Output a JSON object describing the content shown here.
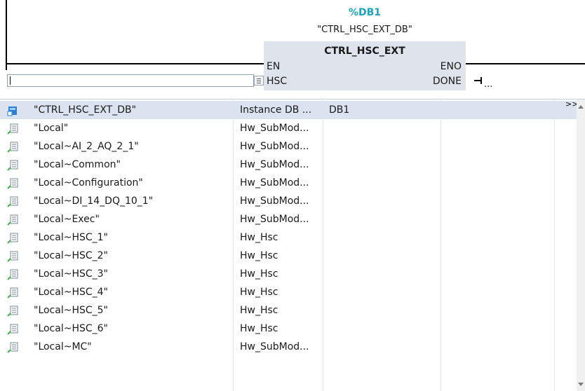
{
  "block": {
    "db_number": "%DB1",
    "db_name": "\"CTRL_HSC_EXT_DB\"",
    "title": "CTRL_HSC_EXT",
    "pins": {
      "en": "EN",
      "eno": "ENO",
      "hsc": "HSC",
      "done": "DONE"
    },
    "done_output": "..."
  },
  "hsc_input": {
    "value": ""
  },
  "dropdown": {
    "more_label": ">>",
    "rows": [
      {
        "icon": "instance-db-icon",
        "name": "\"CTRL_HSC_EXT_DB\"",
        "type": "Instance DB ...",
        "address": "DB1"
      },
      {
        "icon": "hw-tag-icon",
        "name": "\"Local\"",
        "type": "Hw_SubMod...",
        "address": ""
      },
      {
        "icon": "hw-tag-icon",
        "name": "\"Local~AI_2_AQ_2_1\"",
        "type": "Hw_SubMod...",
        "address": ""
      },
      {
        "icon": "hw-tag-icon",
        "name": "\"Local~Common\"",
        "type": "Hw_SubMod...",
        "address": ""
      },
      {
        "icon": "hw-tag-icon",
        "name": "\"Local~Configuration\"",
        "type": "Hw_SubMod...",
        "address": ""
      },
      {
        "icon": "hw-tag-icon",
        "name": "\"Local~DI_14_DQ_10_1\"",
        "type": "Hw_SubMod...",
        "address": ""
      },
      {
        "icon": "hw-tag-icon",
        "name": "\"Local~Exec\"",
        "type": "Hw_SubMod...",
        "address": ""
      },
      {
        "icon": "hw-tag-icon",
        "name": "\"Local~HSC_1\"",
        "type": "Hw_Hsc",
        "address": ""
      },
      {
        "icon": "hw-tag-icon",
        "name": "\"Local~HSC_2\"",
        "type": "Hw_Hsc",
        "address": ""
      },
      {
        "icon": "hw-tag-icon",
        "name": "\"Local~HSC_3\"",
        "type": "Hw_Hsc",
        "address": ""
      },
      {
        "icon": "hw-tag-icon",
        "name": "\"Local~HSC_4\"",
        "type": "Hw_Hsc",
        "address": ""
      },
      {
        "icon": "hw-tag-icon",
        "name": "\"Local~HSC_5\"",
        "type": "Hw_Hsc",
        "address": ""
      },
      {
        "icon": "hw-tag-icon",
        "name": "\"Local~HSC_6\"",
        "type": "Hw_Hsc",
        "address": ""
      },
      {
        "icon": "hw-tag-icon",
        "name": "\"Local~MC\"",
        "type": "Hw_SubMod...",
        "address": ""
      }
    ]
  }
}
